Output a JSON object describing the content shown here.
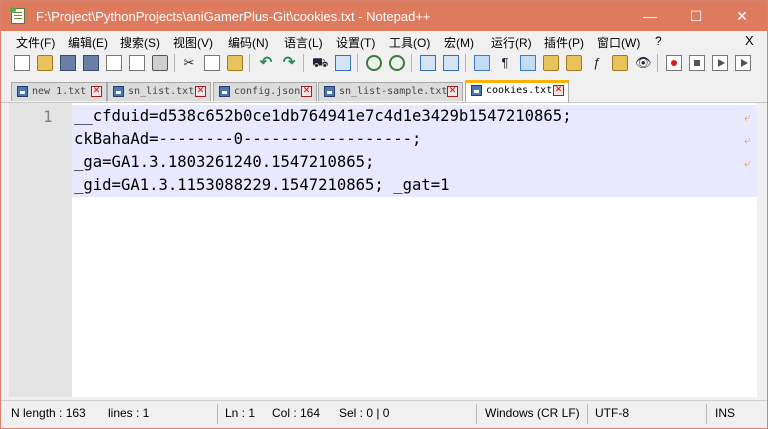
{
  "window": {
    "title": "F:\\Project\\PythonProjects\\aniGamerPlus-Git\\cookies.txt - Notepad++",
    "min_glyph": "—",
    "max_glyph": "☐",
    "close_glyph": "✕",
    "accent": "#de7b5f"
  },
  "menu": {
    "items": [
      "文件(F)",
      "编辑(E)",
      "搜索(S)",
      "视图(V)",
      "编码(N)",
      "语言(L)",
      "设置(T)",
      "工具(O)",
      "宏(M)",
      "运行(R)",
      "插件(P)",
      "窗口(W)",
      "?"
    ],
    "close_glyph": "X"
  },
  "tabs": [
    {
      "label": "new 1.txt",
      "active": false
    },
    {
      "label": "sn_list.txt",
      "active": false
    },
    {
      "label": "config.json",
      "active": false
    },
    {
      "label": "sn_list-sample.txt",
      "active": false
    },
    {
      "label": "cookies.txt",
      "active": true
    }
  ],
  "editor": {
    "line_number": "1",
    "lines": [
      "__cfduid=d538c652b0ce1db764941e7c4d1e3429b1547210865;",
      "ckBahaAd=--------0------------------;",
      "_ga=GA1.3.1803261240.1547210865;",
      "_gid=GA1.3.1153088229.1547210865; _gat=1"
    ],
    "wrap_glyph": "⤶"
  },
  "statusbar": {
    "length": "N length : 163",
    "lines": "lines : 1",
    "ln": "Ln : 1",
    "col": "Col : 164",
    "sel": "Sel : 0 | 0",
    "eol": "Windows (CR LF)",
    "encoding": "UTF-8",
    "mode": "INS"
  }
}
